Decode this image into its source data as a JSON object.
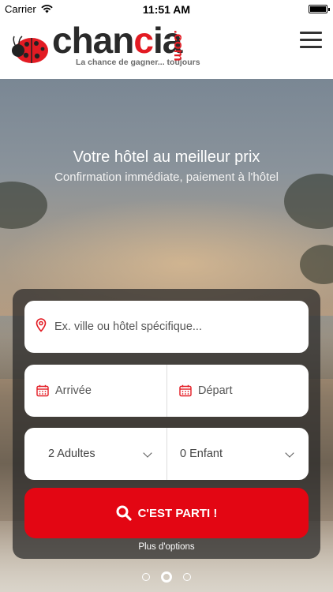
{
  "status": {
    "carrier": "Carrier",
    "time": "11:51 AM"
  },
  "brand": {
    "wordmark_a": "chan",
    "wordmark_b": "c",
    "wordmark_c": "ia",
    "com": ".com",
    "tagline": "La chance de gagner... toujours",
    "accent": "#e31b23"
  },
  "hero": {
    "title": "Votre hôtel au meilleur prix",
    "subtitle": "Confirmation immédiate, paiement à l'hôtel"
  },
  "search": {
    "destination_placeholder": "Ex. ville ou hôtel spécifique...",
    "arrival_label": "Arrivée",
    "departure_label": "Départ",
    "adults_value": "2 Adultes",
    "children_value": "0 Enfant",
    "submit_label": "C'EST PARTI !",
    "more_options": "Plus d'options",
    "button_color": "#e30613"
  },
  "carousel": {
    "count": 3,
    "active_index": 1
  }
}
